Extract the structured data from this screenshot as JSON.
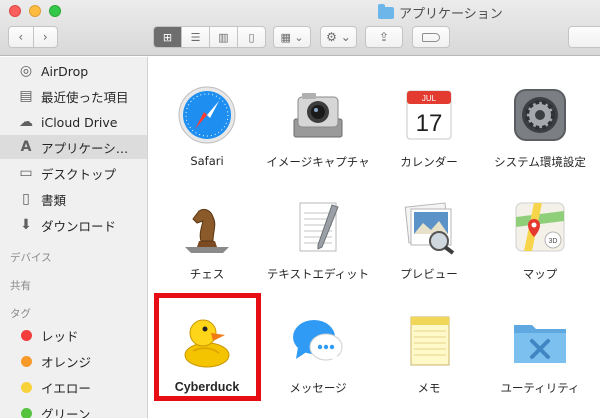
{
  "window": {
    "title": "アプリケーション",
    "title_icon": "folder-icon"
  },
  "toolbar": {
    "back_icon": "‹",
    "forward_icon": "›",
    "view_icons": "⊞",
    "view_list": "☰",
    "view_columns": "▥",
    "view_coverflow": "▯",
    "arrange": "▦ ⌄",
    "action": "⚙ ⌄",
    "share": "⇪"
  },
  "sidebar": {
    "favorites": [
      {
        "label": "AirDrop",
        "icon": "airdrop-icon",
        "glyph": "◎"
      },
      {
        "label": "最近使った項目",
        "icon": "recents-icon",
        "glyph": "▤"
      },
      {
        "label": "iCloud Drive",
        "icon": "cloud-icon",
        "glyph": "☁"
      },
      {
        "label": "アプリケーシ…",
        "icon": "applications-icon",
        "glyph": "A",
        "selected": true
      },
      {
        "label": "デスクトップ",
        "icon": "desktop-icon",
        "glyph": "▭"
      },
      {
        "label": "書類",
        "icon": "documents-icon",
        "glyph": "▯"
      },
      {
        "label": "ダウンロード",
        "icon": "download-icon",
        "glyph": "⬇"
      }
    ],
    "devices_heading": "デバイス",
    "shared_heading": "共有",
    "tags_heading": "タグ",
    "tags": [
      {
        "label": "レッド",
        "color": "#f33c3c"
      },
      {
        "label": "オレンジ",
        "color": "#f89a2a"
      },
      {
        "label": "イエロー",
        "color": "#f7d23a"
      },
      {
        "label": "グリーン",
        "color": "#54c43f"
      }
    ]
  },
  "apps": [
    {
      "label": "Safari",
      "icon": "safari-icon"
    },
    {
      "label": "イメージキャプチャ",
      "icon": "image-capture-icon"
    },
    {
      "label": "カレンダー",
      "icon": "calendar-icon",
      "month": "JUL",
      "day": "17"
    },
    {
      "label": "システム環境設定",
      "icon": "system-preferences-icon"
    },
    {
      "label": "チェス",
      "icon": "chess-icon"
    },
    {
      "label": "テキストエディット",
      "icon": "textedit-icon"
    },
    {
      "label": "プレビュー",
      "icon": "preview-icon"
    },
    {
      "label": "マップ",
      "icon": "maps-icon",
      "badge": "3D"
    },
    {
      "label": "Cyberduck",
      "icon": "cyberduck-icon",
      "highlighted": true
    },
    {
      "label": "メッセージ",
      "icon": "messages-icon"
    },
    {
      "label": "メモ",
      "icon": "notes-icon"
    },
    {
      "label": "ユーティリティ",
      "icon": "utilities-folder-icon"
    }
  ],
  "colors": {
    "highlight": "#e60e14",
    "folder": "#6cb6ea",
    "sidebar_bg": "#f0f0f0"
  }
}
